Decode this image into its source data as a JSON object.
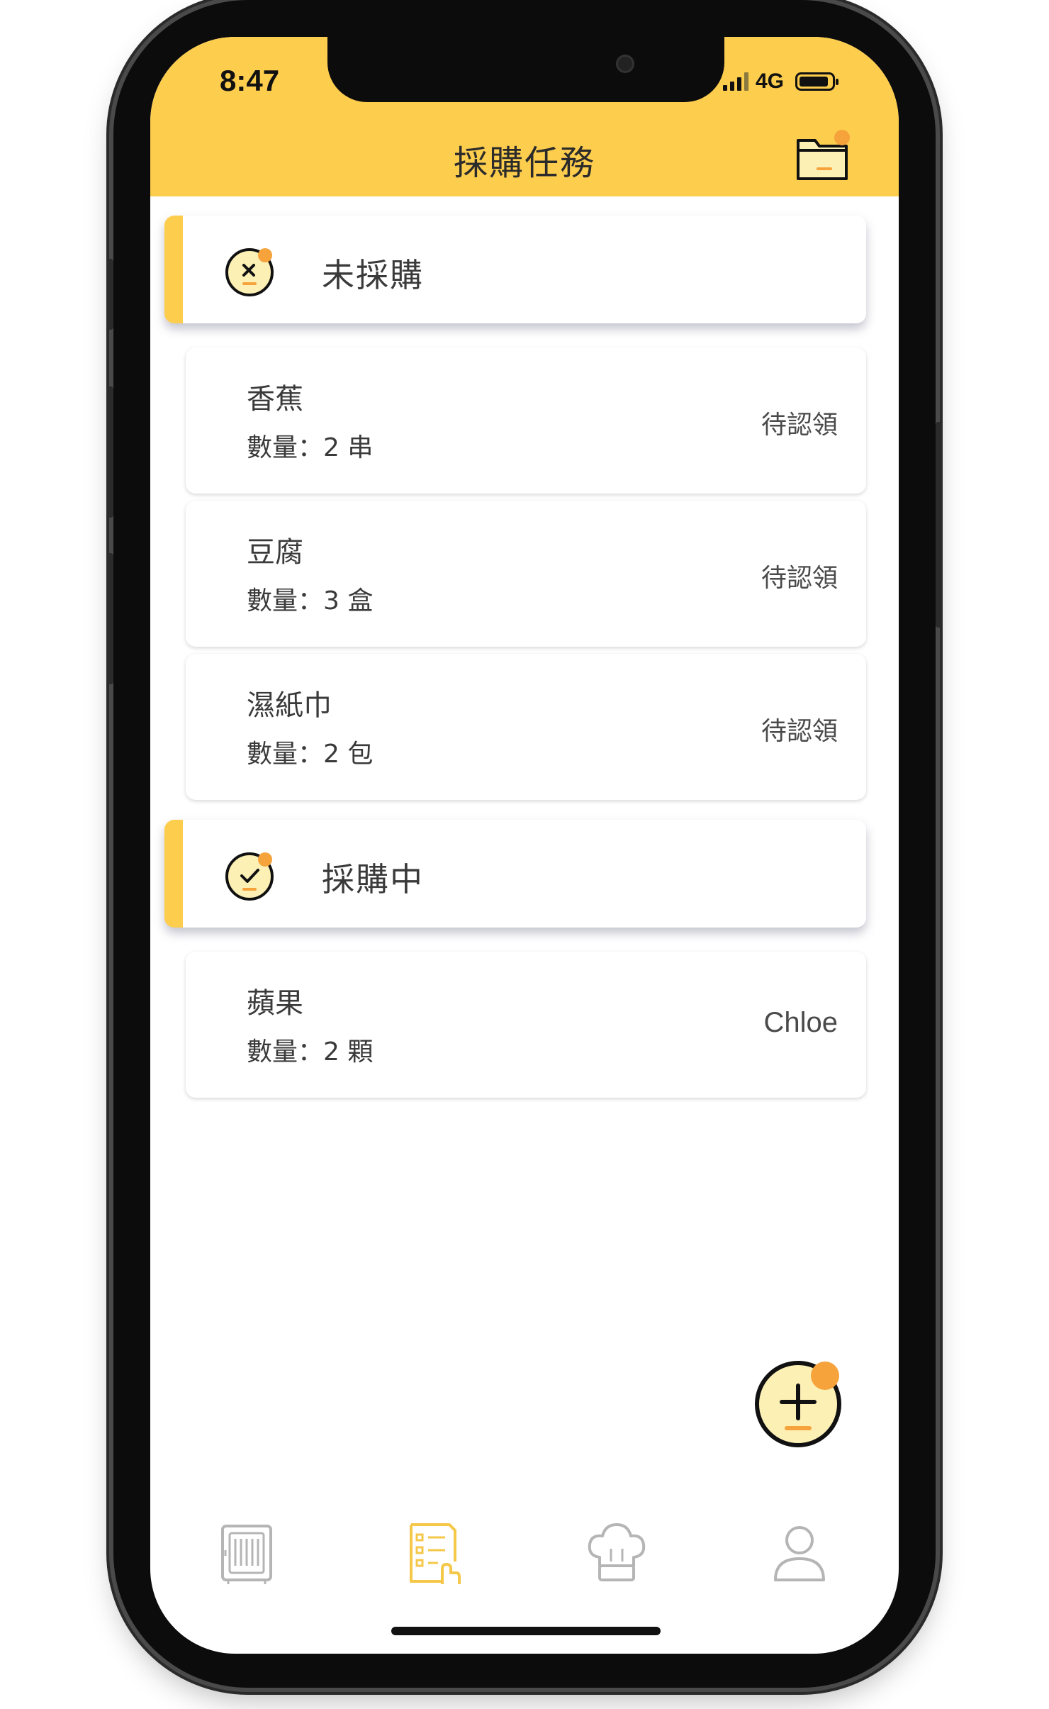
{
  "status_bar": {
    "time": "8:47",
    "network": "4G"
  },
  "header": {
    "title": "採購任務"
  },
  "sections": [
    {
      "label": "未採購",
      "items": [
        {
          "name": "香蕉",
          "quantity": "數量：2 串",
          "status": "待認領"
        },
        {
          "name": "豆腐",
          "quantity": "數量：3 盒",
          "status": "待認領"
        },
        {
          "name": "濕紙巾",
          "quantity": "數量：2 包",
          "status": "待認領"
        }
      ]
    },
    {
      "label": "採購中",
      "items": [
        {
          "name": "蘋果",
          "quantity": "數量：2 顆",
          "status": "Chloe"
        }
      ]
    }
  ],
  "icons": {
    "header_action": "folder-icon",
    "section_0": "cross-circle-icon",
    "section_1": "check-circle-icon",
    "fab": "plus-icon",
    "tabs": [
      "fridge-icon",
      "task-list-icon",
      "chef-hat-icon",
      "user-icon"
    ]
  },
  "colors": {
    "accent": "#fdcd4d",
    "accent_orange": "#f6a33c",
    "icon_fill": "#fdf0b5",
    "active_tab": "#f5c84a",
    "inactive_tab": "#b5b5b5"
  },
  "tabs": {
    "active_index": 1
  }
}
